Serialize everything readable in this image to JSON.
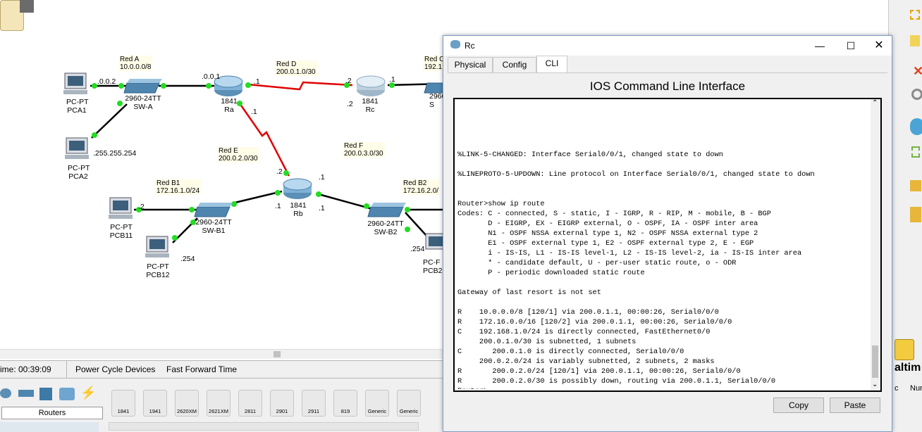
{
  "topology": {
    "networks": [
      {
        "name": "Red A",
        "addr": "10.0.0.0/8"
      },
      {
        "name": "Red D",
        "addr": "200.0.1.0/30"
      },
      {
        "name": "Red C",
        "addr": "192.1"
      },
      {
        "name": "Red E",
        "addr": "200.0.2.0/30"
      },
      {
        "name": "Red F",
        "addr": "200.0.3.0/30"
      },
      {
        "name": "Red B1",
        "addr": "172.16.1.0/24"
      },
      {
        "name": "Red B2",
        "addr": "172.16.2.0/"
      }
    ],
    "devices": {
      "pca1": {
        "type": "PC-PT",
        "name": "PCA1"
      },
      "pca2": {
        "type": "PC-PT",
        "name": "PCA2"
      },
      "pcb11": {
        "type": "PC-PT",
        "name": "PCB11"
      },
      "pcb12": {
        "type": "PC-PT",
        "name": "PCB12"
      },
      "pcb2": {
        "type": "PC-F",
        "name": "PCB2"
      },
      "swa": {
        "type": "2960-24TT",
        "name": "SW-A"
      },
      "swb1": {
        "type": "2960-24TT",
        "name": "SW-B1"
      },
      "swb2": {
        "type": "2960-24TT",
        "name": "SW-B2"
      },
      "swc": {
        "type": "2960",
        "name": "S"
      },
      "ra": {
        "type": "1841",
        "name": "Ra"
      },
      "rb": {
        "type": "1841",
        "name": "Rb"
      },
      "rc": {
        "type": "1841",
        "name": "Rc"
      }
    },
    "port_labels": {
      "pca1_ip": ".0.0.2",
      "ra_lan": ".0.0.1",
      "ra_d": ".1",
      "rc_d": ".2",
      "rc_c": ".1",
      "rc_c2": ".2",
      "ra_e": ".1",
      "rb_e": ".2",
      "rb_f": ".1",
      "rb_b1": ".1",
      "rb_b2": ".1",
      "pca2_mask": ".255.255.254",
      "pcb11_ip": ".2",
      "pcb12_ip": ".254",
      "pcb2_ip": ".254"
    }
  },
  "status_bar": {
    "time": "ime: 00:39:09",
    "power_cycle": "Power Cycle Devices",
    "fast_forward": "Fast Forward Time"
  },
  "device_panel": {
    "category": "Routers",
    "models": [
      "1841",
      "1941",
      "2620XM",
      "2621XM",
      "2811",
      "2901",
      "2911",
      "819",
      "Generic",
      "Generic"
    ]
  },
  "right_strip": {
    "realtime_label": "altim",
    "num_label": "Nur",
    "c_label": "c"
  },
  "rc_window": {
    "title": "Rc",
    "tabs": [
      "Physical",
      "Config",
      "CLI"
    ],
    "active_tab": "CLI",
    "heading": "IOS Command Line Interface",
    "cli_lines": [
      "",
      "",
      "",
      "",
      "",
      "%LINK-5-CHANGED: Interface Serial0/0/1, changed state to down",
      "",
      "%LINEPROTO-5-UPDOWN: Line protocol on Interface Serial0/0/1, changed state to down",
      "",
      "",
      "Router>show ip route",
      "Codes: C - connected, S - static, I - IGRP, R - RIP, M - mobile, B - BGP",
      "       D - EIGRP, EX - EIGRP external, O - OSPF, IA - OSPF inter area",
      "       N1 - OSPF NSSA external type 1, N2 - OSPF NSSA external type 2",
      "       E1 - OSPF external type 1, E2 - OSPF external type 2, E - EGP",
      "       i - IS-IS, L1 - IS-IS level-1, L2 - IS-IS level-2, ia - IS-IS inter area",
      "       * - candidate default, U - per-user static route, o - ODR",
      "       P - periodic downloaded static route",
      "",
      "Gateway of last resort is not set",
      "",
      "R    10.0.0.0/8 [120/1] via 200.0.1.1, 00:00:26, Serial0/0/0",
      "R    172.16.0.0/16 [120/2] via 200.0.1.1, 00:00:26, Serial0/0/0",
      "C    192.168.1.0/24 is directly connected, FastEthernet0/0",
      "     200.0.1.0/30 is subnetted, 1 subnets",
      "C       200.0.1.0 is directly connected, Serial0/0/0",
      "     200.0.2.0/24 is variably subnetted, 2 subnets, 2 masks",
      "R       200.0.2.0/24 [120/1] via 200.0.1.1, 00:00:26, Serial0/0/0",
      "R       200.0.2.0/30 is possibly down, routing via 200.0.1.1, Serial0/0/0",
      "Router>"
    ],
    "copy_label": "Copy",
    "paste_label": "Paste"
  },
  "colors": {
    "link_ethernet": "#000000",
    "link_serial": "#e00000",
    "port_up": "#22dd22",
    "window_border": "#7a9cc6"
  }
}
